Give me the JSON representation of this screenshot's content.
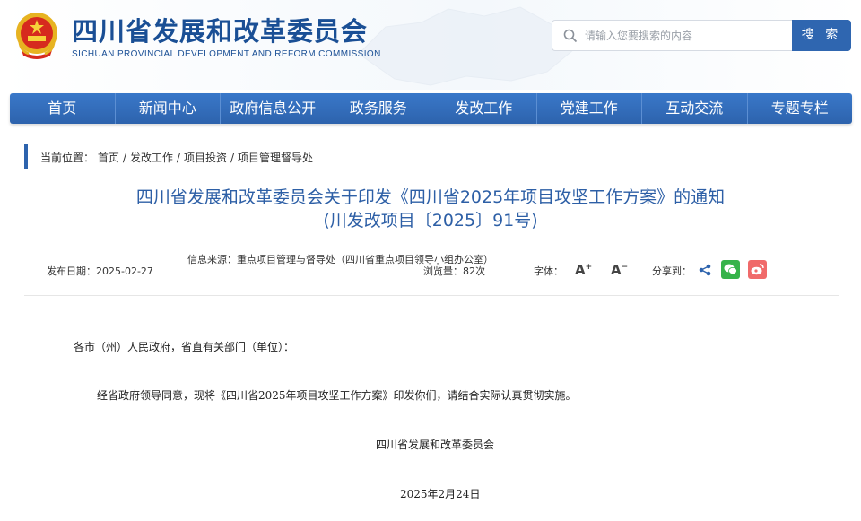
{
  "header": {
    "org_name_cn": "四川省发展和改革委员会",
    "org_name_en": "SICHUAN PROVINCIAL DEVELOPMENT AND REFORM COMMISSION",
    "search_placeholder": "请输入您要搜索的内容",
    "search_button": "搜 索",
    "emblem_icon": "national-emblem-icon",
    "accent_color": "#2d63ad"
  },
  "nav": {
    "items": [
      "首页",
      "新闻中心",
      "政府信息公开",
      "政务服务",
      "发改工作",
      "党建工作",
      "互动交流",
      "专题专栏"
    ]
  },
  "breadcrumb": {
    "label": "当前位置：",
    "items": [
      "首页",
      "发改工作",
      "项目投资",
      "项目管理督导处"
    ],
    "separator": "/"
  },
  "article": {
    "title_line1": "四川省发展和改革委员会关于印发《四川省2025年项目攻坚工作方案》的通知",
    "title_line2": "(川发改项目〔2025〕91号)",
    "publish_date_label": "发布日期：",
    "publish_date": "2025-02-27",
    "source_label": "信息来源：",
    "source": "重点项目管理与督导处（四川省重点项目领导小组办公室）",
    "views_label": "浏览量：",
    "views": "82次",
    "font_label": "字体：",
    "font_increase": "A",
    "font_decrease": "A",
    "share_label": "分享到：",
    "salutation": "各市（州）人民政府，省直有关部门（单位）：",
    "paragraph": "经省政府领导同意，现将《四川省2025年项目攻坚工作方案》印发你们，请结合实际认真贯彻实施。",
    "signature": "四川省发展和改革委员会",
    "sign_date": "2025年2月24日"
  }
}
